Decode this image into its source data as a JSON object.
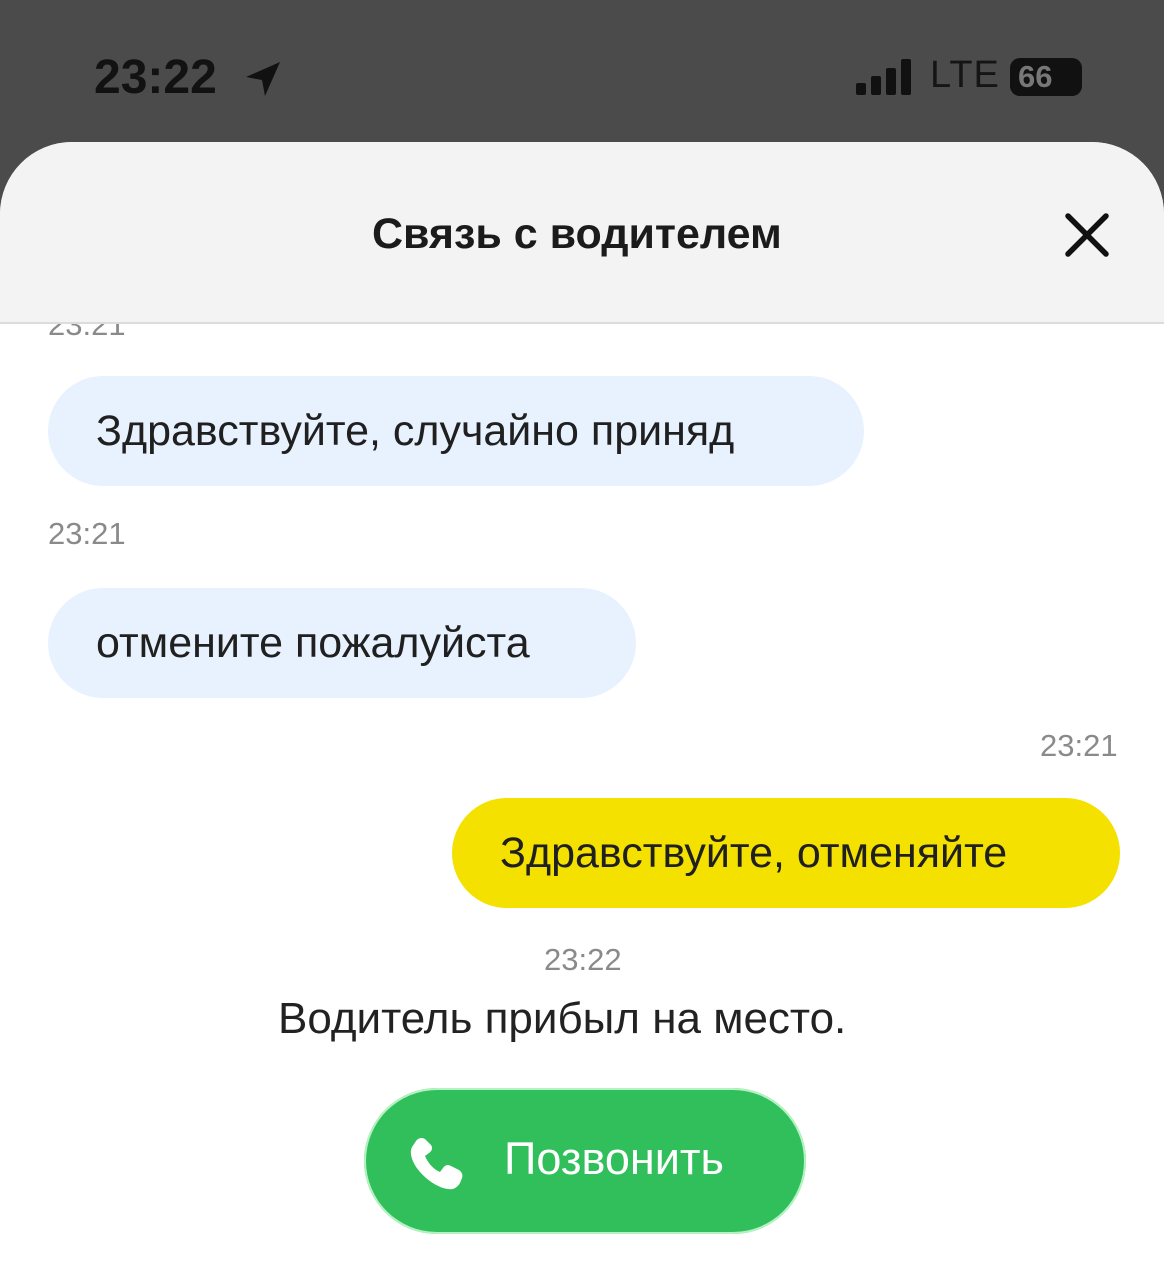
{
  "status_bar": {
    "time": "23:22",
    "network": "LTE",
    "battery": "66",
    "icons": [
      "location-arrow-icon",
      "signal-bars-icon",
      "battery-icon"
    ]
  },
  "header": {
    "title": "Связь с водителем",
    "close_icon": "close-icon"
  },
  "messages": [
    {
      "timestamp": "23:21",
      "text": "Здравствуйте, случайно приняд",
      "direction": "incoming"
    },
    {
      "timestamp": "23:21",
      "text": "отмените пожалуйста",
      "direction": "incoming"
    },
    {
      "timestamp": "23:21",
      "text": "Здравствуйте, отменяйте",
      "direction": "outgoing"
    }
  ],
  "system_event": {
    "timestamp": "23:22",
    "text": "Водитель прибыл на место."
  },
  "call_button": {
    "label": "Позвонить",
    "icon": "phone-icon"
  },
  "colors": {
    "incoming_bubble": "#e8f2ff",
    "outgoing_bubble": "#f4e100",
    "call_button": "#31bf5b",
    "header_background": "#f3f3f3",
    "timestamp": "#8a8a8a"
  }
}
